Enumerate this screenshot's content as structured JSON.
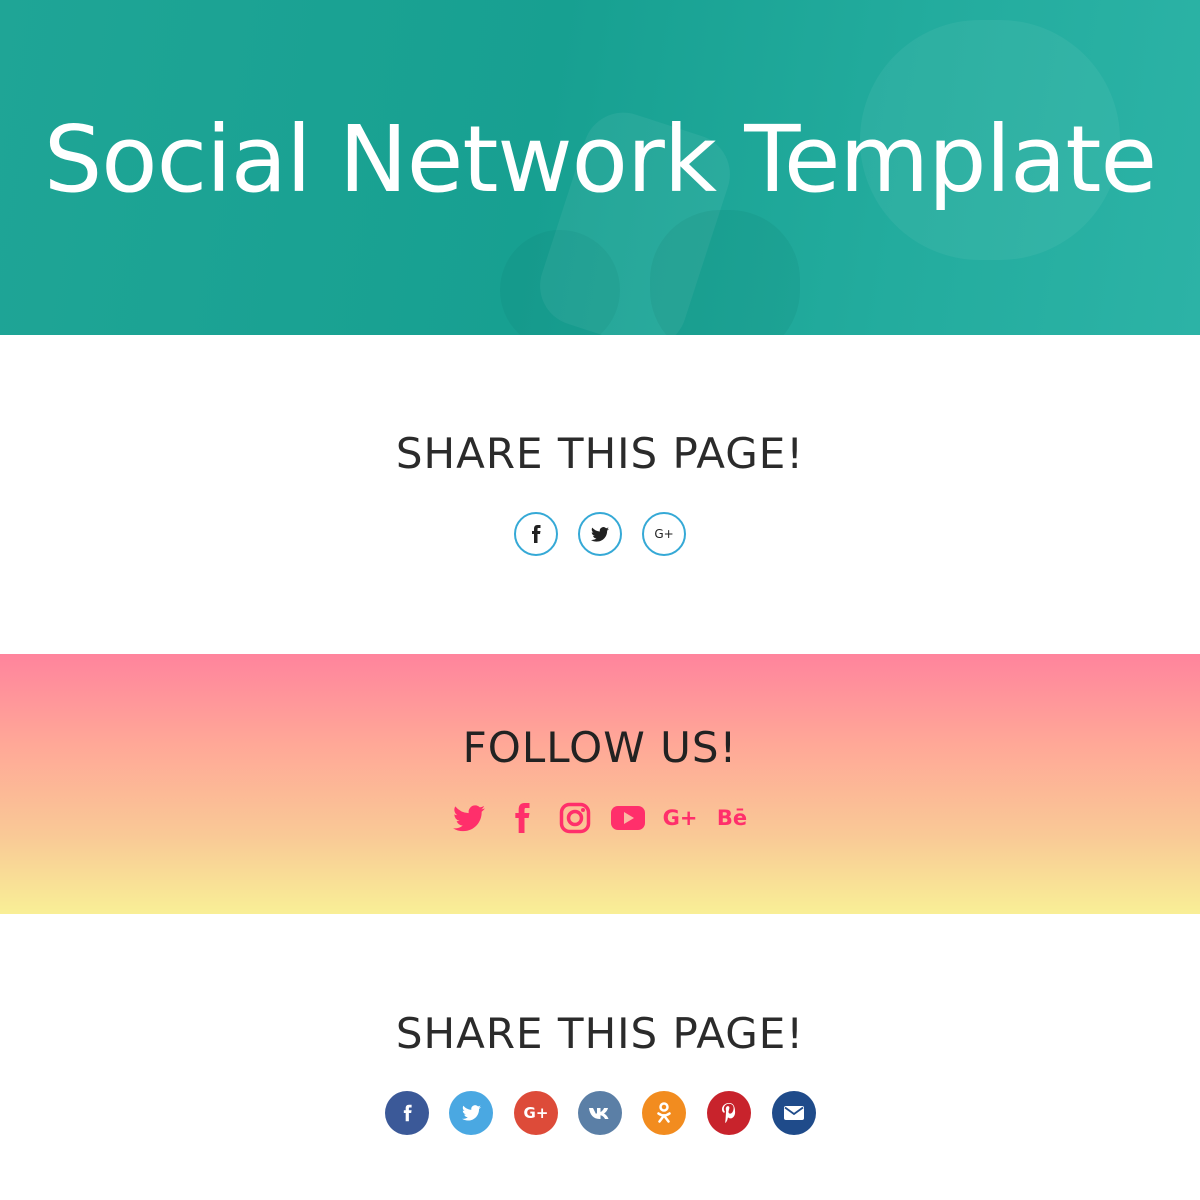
{
  "hero": {
    "title": "Social Network Template"
  },
  "share_section_1": {
    "heading": "SHARE THIS PAGE!",
    "style_color": "#35a9d6",
    "buttons": [
      {
        "icon": "facebook-icon"
      },
      {
        "icon": "twitter-icon"
      },
      {
        "icon": "google-plus-icon",
        "label": "G+"
      }
    ]
  },
  "follow_section": {
    "heading": "FOLLOW US!",
    "icon_color": "#ff2f6b",
    "gradient": [
      "#ff849d",
      "#f9ef96"
    ],
    "icons": [
      {
        "icon": "twitter-icon"
      },
      {
        "icon": "facebook-icon"
      },
      {
        "icon": "instagram-icon"
      },
      {
        "icon": "youtube-icon"
      },
      {
        "icon": "google-plus-icon",
        "label": "G+"
      },
      {
        "icon": "behance-icon",
        "label": "Bē"
      }
    ]
  },
  "share_section_2": {
    "heading": "SHARE THIS PAGE!",
    "buttons": [
      {
        "icon": "facebook-icon",
        "color": "#3b5998"
      },
      {
        "icon": "twitter-icon",
        "color": "#4aa8e2"
      },
      {
        "icon": "google-plus-icon",
        "color": "#dd4b39",
        "label": "G+"
      },
      {
        "icon": "vk-icon",
        "color": "#5b7fa6"
      },
      {
        "icon": "odnoklassniki-icon",
        "color": "#f28c1f"
      },
      {
        "icon": "pinterest-icon",
        "color": "#c8232c"
      },
      {
        "icon": "mail-icon",
        "color": "#1f4b8a"
      }
    ]
  },
  "colors": {
    "hero_teal": "#1fa596",
    "text_dark": "#2b2b2b"
  }
}
